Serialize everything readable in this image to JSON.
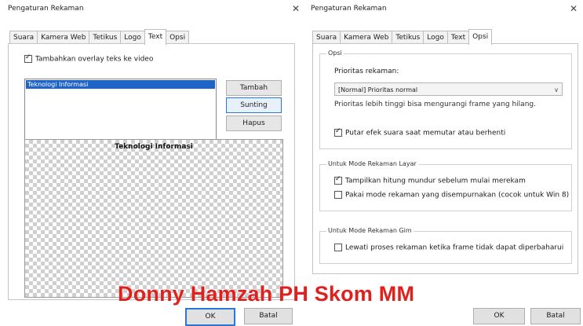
{
  "left_window": {
    "title": "Pengaturan Rekaman",
    "tabs": [
      "Suara",
      "Kamera Web",
      "Tetikus",
      "Logo",
      "Text",
      "Opsi"
    ],
    "active_tab": "Text",
    "overlay_checkbox": {
      "label": "Tambahkan overlay teks ke video",
      "checked": true
    },
    "text_list": {
      "items": [
        "Teknologi Informasi"
      ],
      "selected": "Teknologi Informasi"
    },
    "buttons": {
      "add": "Tambah",
      "edit": "Sunting",
      "delete": "Hapus"
    },
    "preview": {
      "overlay_text": "Teknologi Informasi"
    },
    "footer": {
      "ok": "OK",
      "cancel": "Batal"
    }
  },
  "right_window": {
    "title": "Pengaturan Rekaman",
    "tabs": [
      "Suara",
      "Kamera Web",
      "Tetikus",
      "Logo",
      "Text",
      "Opsi"
    ],
    "active_tab": "Opsi",
    "options_group": {
      "label": "Opsi",
      "priority_label": "Prioritas rekaman:",
      "priority_value": "[Normal] Prioritas normal",
      "priority_hint": "Prioritas lebih tinggi bisa mengurangi frame yang hilang.",
      "sound_checkbox": {
        "label": "Putar efek suara saat memutar atau berhenti",
        "checked": true
      }
    },
    "screen_mode_group": {
      "label": "Untuk Mode Rekaman Layar",
      "countdown": {
        "label": "Tampilkan hitung mundur sebelum mulai merekam",
        "checked": true
      },
      "improved_mode": {
        "label": "Pakai mode rekaman yang disempurnakan (cocok untuk Win 8)",
        "checked": false
      }
    },
    "game_mode_group": {
      "label": "Untuk Mode Rekaman Gim",
      "skip": {
        "label": "Lewati proses rekaman ketika frame tidak dapat diperbaharui",
        "checked": false
      }
    },
    "footer": {
      "ok": "OK",
      "cancel": "Batal"
    }
  },
  "watermark": "Donny Hamzah PH Skom MM",
  "icons": {
    "close": "close-icon",
    "dropdown": "chevron-down-icon",
    "check": "checkbox-check-icon"
  },
  "colors": {
    "selection": "#1e63c7",
    "watermark": "#e0201d",
    "focus_border": "#2a78d6"
  }
}
